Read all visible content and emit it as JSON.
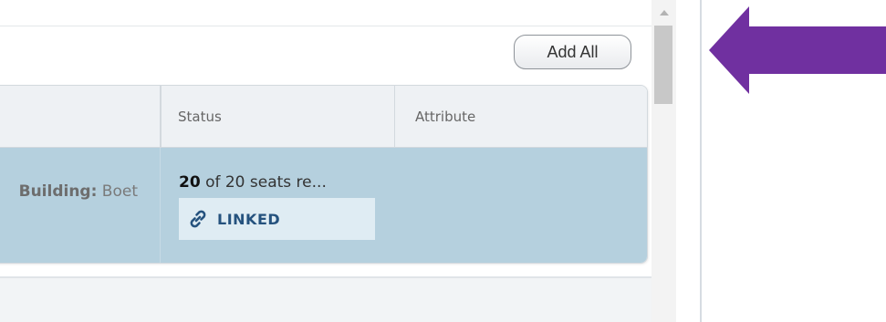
{
  "toolbar": {
    "add_all_label": "Add All"
  },
  "table": {
    "columns": [
      "Status",
      "Attribute"
    ],
    "rows": [
      {
        "building_label": "Building:",
        "building_value": "Boet",
        "seats_count": "20",
        "seats_rest": " of 20 seats re...",
        "status_badge": "LINKED",
        "attribute": ""
      }
    ]
  },
  "icons": {
    "link": "link-icon",
    "scroll_up": "chevron-up-icon",
    "annotation": "arrow-left-icon"
  },
  "colors": {
    "selected_row": "#b5d0de",
    "linked_badge_bg": "#dfecf3",
    "linked_text": "#25527e",
    "annotation_arrow": "#7030a0"
  }
}
